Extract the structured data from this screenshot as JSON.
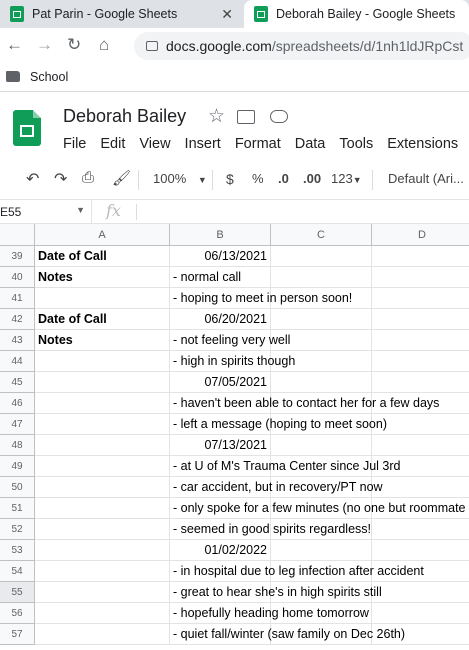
{
  "browser": {
    "tabs": [
      {
        "title": "Pat Parin - Google Sheets",
        "active": false
      },
      {
        "title": "Deborah Bailey - Google Sheets",
        "active": true
      }
    ],
    "url_host": "docs.google.com",
    "url_path": "/spreadsheets/d/1nh1ldJRpCst",
    "bookmark": "School"
  },
  "doc": {
    "title": "Deborah Bailey",
    "menus": [
      "File",
      "Edit",
      "View",
      "Insert",
      "Format",
      "Data",
      "Tools",
      "Extensions"
    ]
  },
  "toolbar": {
    "zoom": "100%",
    "currency": "$",
    "percent": "%",
    "dec_decrease": ".0",
    "dec_increase": ".00",
    "number_format": "123",
    "font": "Default (Ari..."
  },
  "formula_bar": {
    "cell_ref": "E55",
    "fx": "fx",
    "content": ""
  },
  "columns": [
    "A",
    "B",
    "C",
    "D"
  ],
  "rows": [
    {
      "num": "39",
      "a": "Date of Call",
      "b": "06/13/2021",
      "b_align": "right"
    },
    {
      "num": "40",
      "a": "Notes",
      "b": "- normal call",
      "b_align": "left"
    },
    {
      "num": "41",
      "a": "",
      "b": "- hoping to meet in person soon!",
      "b_align": "left"
    },
    {
      "num": "42",
      "a": "Date of Call",
      "b": "06/20/2021",
      "b_align": "right"
    },
    {
      "num": "43",
      "a": "Notes",
      "b": "- not feeling very well",
      "b_align": "left"
    },
    {
      "num": "44",
      "a": "",
      "b": "- high in spirits though",
      "b_align": "left"
    },
    {
      "num": "45",
      "a": "",
      "b": "07/05/2021",
      "b_align": "right"
    },
    {
      "num": "46",
      "a": "",
      "b": "- haven't been able to contact her for a few days",
      "b_align": "left"
    },
    {
      "num": "47",
      "a": "",
      "b": "- left a message (hoping to meet soon)",
      "b_align": "left"
    },
    {
      "num": "48",
      "a": "",
      "b": "07/13/2021",
      "b_align": "right"
    },
    {
      "num": "49",
      "a": "",
      "b": "- at U of M's Trauma Center since Jul 3rd",
      "b_align": "left"
    },
    {
      "num": "50",
      "a": "",
      "b": "- car accident, but in recovery/PT now",
      "b_align": "left"
    },
    {
      "num": "51",
      "a": "",
      "b": "- only spoke for a few minutes (no one but roommate",
      "b_align": "left"
    },
    {
      "num": "52",
      "a": "",
      "b": "- seemed in good spirits regardless!",
      "b_align": "left"
    },
    {
      "num": "53",
      "a": "",
      "b": "01/02/2022",
      "b_align": "right"
    },
    {
      "num": "54",
      "a": "",
      "b": "- in hospital due to leg infection after accident",
      "b_align": "left"
    },
    {
      "num": "55",
      "a": "",
      "b": "- great to hear she's in high spirits still",
      "b_align": "left"
    },
    {
      "num": "56",
      "a": "",
      "b": "- hopefully heading home tomorrow",
      "b_align": "left"
    },
    {
      "num": "57",
      "a": "",
      "b": "- quiet fall/winter (saw family on Dec 26th)",
      "b_align": "left"
    }
  ],
  "selected_row": "55"
}
